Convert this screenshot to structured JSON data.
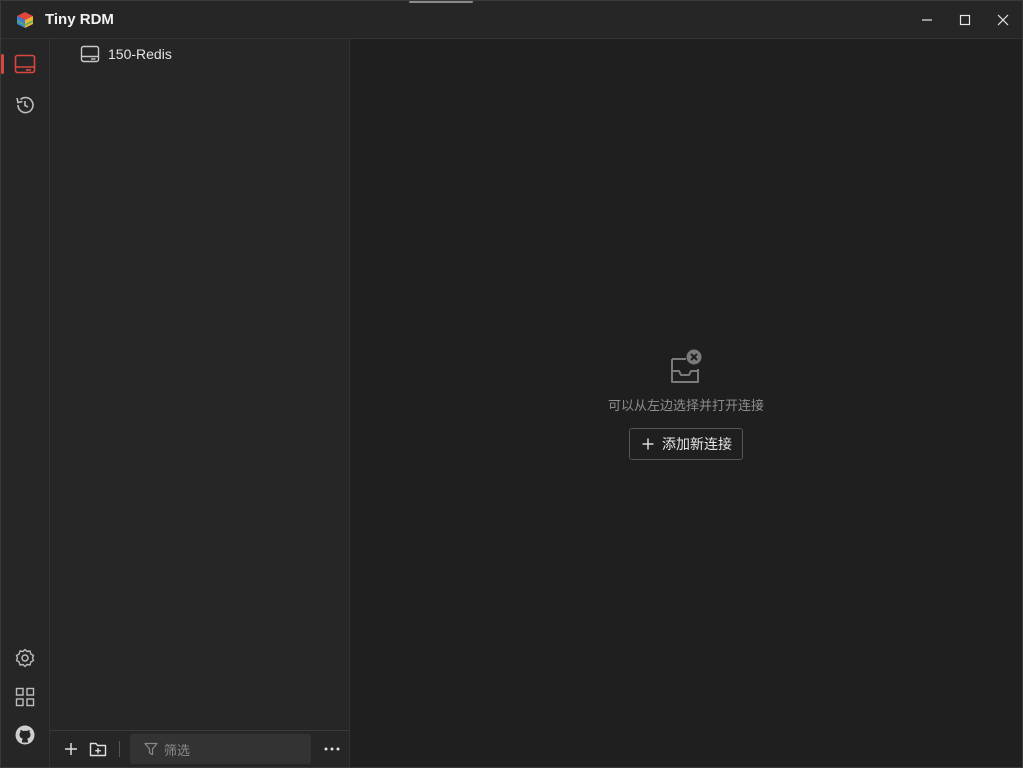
{
  "titlebar": {
    "title": "Tiny RDM"
  },
  "rail": {
    "items": [
      {
        "name": "connections",
        "icon": "server-icon",
        "active": true
      },
      {
        "name": "history",
        "icon": "history-icon",
        "active": false
      }
    ],
    "bottom": [
      {
        "name": "settings",
        "icon": "gear-icon"
      },
      {
        "name": "apps",
        "icon": "grid-icon"
      },
      {
        "name": "github",
        "icon": "github-icon"
      }
    ]
  },
  "connections": {
    "items": [
      {
        "label": "150-Redis",
        "icon": "server-icon"
      }
    ],
    "filter_placeholder": "筛选"
  },
  "main": {
    "empty_hint": "可以从左边选择并打开连接",
    "add_connection_label": "添加新连接"
  },
  "colors": {
    "accent": "#d8473f",
    "background": "#1f1f1f",
    "panel": "#262626"
  }
}
